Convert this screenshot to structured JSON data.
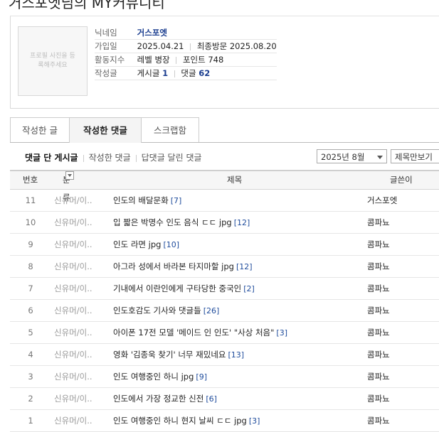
{
  "page_title": "거스포엣님의 MY커뮤니티",
  "profile": {
    "photo_placeholder": "프로필 사진을 등록해주세요",
    "nickname_label": "닉네임",
    "nickname": "거스포엣",
    "join_label": "가입일",
    "join_date": "2025.04.21",
    "last_visit_label": "최종방문",
    "last_visit": "2025.08.20",
    "activity_label": "활동지수",
    "level": "레벨 병장",
    "point_label": "포인트",
    "points": "748",
    "written_label": "작성글",
    "posts_label": "게시글",
    "posts_count": "1",
    "comments_label": "댓글",
    "comments_count": "62"
  },
  "tabs": [
    "작성한 글",
    "작성한 댓글",
    "스크랩함"
  ],
  "active_tab": 1,
  "subnav": [
    "댓글 단 게시글",
    "작성한 댓글",
    "답댓글 달린 댓글"
  ],
  "month_select": "2025년 8월",
  "view_select": "제목만보기",
  "table": {
    "headers": {
      "num": "번호",
      "category": "분류",
      "title": "제목",
      "author": "글쓴이"
    },
    "rows": [
      {
        "num": "11",
        "category": "신유머/이..",
        "title": "인도의 배달문화",
        "count": "[7]",
        "author": "거스포엣"
      },
      {
        "num": "10",
        "category": "신유머/이..",
        "title": "입 짧은 박명수 인도 음식 ㄷㄷ jpg",
        "count": "[12]",
        "author": "콤파뇨"
      },
      {
        "num": "9",
        "category": "신유머/이..",
        "title": "인도 라면 jpg",
        "count": "[10]",
        "author": "콤파뇨"
      },
      {
        "num": "8",
        "category": "신유머/이..",
        "title": "아그라 성에서 바라본 타지마할 jpg",
        "count": "[12]",
        "author": "콤파뇨"
      },
      {
        "num": "7",
        "category": "신유머/이..",
        "title": "기내에서 이란인에게 구타당한 중국인",
        "count": "[2]",
        "author": "콤파뇨"
      },
      {
        "num": "6",
        "category": "신유머/이..",
        "title": "인도호감도 기사와 댓글들",
        "count": "[26]",
        "author": "콤파뇨"
      },
      {
        "num": "5",
        "category": "신유머/이..",
        "title": "아이폰 17전 모델 '메이드 인 인도' \"사상 처음\"",
        "count": "[3]",
        "author": "콤파뇨"
      },
      {
        "num": "4",
        "category": "신유머/이..",
        "title": "영화 '김종욱 찾기' 너무 재밌네요",
        "count": "[13]",
        "author": "콤파뇨"
      },
      {
        "num": "3",
        "category": "신유머/이..",
        "title": "인도 여행중인 하니 jpg",
        "count": "[9]",
        "author": "콤파뇨"
      },
      {
        "num": "2",
        "category": "신유머/이..",
        "title": "인도에서 가장 정교한 신전",
        "count": "[6]",
        "author": "콤파뇨"
      },
      {
        "num": "1",
        "category": "신유머/이..",
        "title": "인도 여행중인 하니 현지 날씨 ㄷㄷ jpg",
        "count": "[3]",
        "author": "콤파뇨"
      }
    ]
  }
}
